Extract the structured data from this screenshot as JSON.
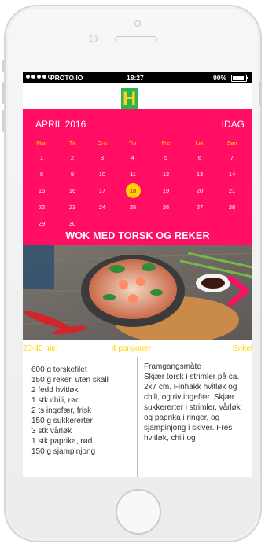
{
  "status_bar": {
    "carrier": "PROTO.IO",
    "time": "18:27",
    "battery": "90%"
  },
  "calendar": {
    "month": "APRIL 2016",
    "today_label": "IDAG",
    "weekdays": [
      "Man",
      "Tir",
      "Ons",
      "Tor",
      "Fre",
      "Lør",
      "Søn"
    ],
    "weeks": [
      [
        "1",
        "2",
        "3",
        "4",
        "5",
        "6",
        "7"
      ],
      [
        "8",
        "9",
        "10",
        "11",
        "12",
        "13",
        "14"
      ],
      [
        "15",
        "16",
        "17",
        "18",
        "19",
        "20",
        "21"
      ],
      [
        "22",
        "23",
        "24",
        "25",
        "26",
        "27",
        "28"
      ],
      [
        "29",
        "30",
        "",
        "",
        "",
        "",
        ""
      ]
    ],
    "selected_day": "18"
  },
  "recipe": {
    "title": "WOK MED TORSK OG REKER",
    "time": "20-40 min",
    "portions": "4 porsjoner",
    "difficulty": "Enkel",
    "ingredients": [
      "600 g torskefilet",
      "150 g reker, uten skall",
      "2 fedd hvitløk",
      "1 stk chili, rød",
      "2 ts ingefær, frisk",
      "150 g sukkererter",
      "3 stk vårløk",
      "1 stk paprika, rød",
      "150 g sjampinjong"
    ],
    "method_heading": "Framgangsmåte",
    "method_text": "Skjær torsk i strimler på ca. 2x7 cm. Finhakk hvitløk og chili, og riv ingefær. Skjær sukkererter i strimler, vårløk og paprika i ringer, og sjampinjong i skiver. Fres hvitløk, chili og"
  },
  "colors": {
    "accent": "#ff0e63",
    "highlight": "#ffd400",
    "logo_green": "#2db54a"
  },
  "icons": {
    "logo": "H-logo-icon",
    "next": "chevron-right-icon",
    "battery": "battery-icon"
  }
}
